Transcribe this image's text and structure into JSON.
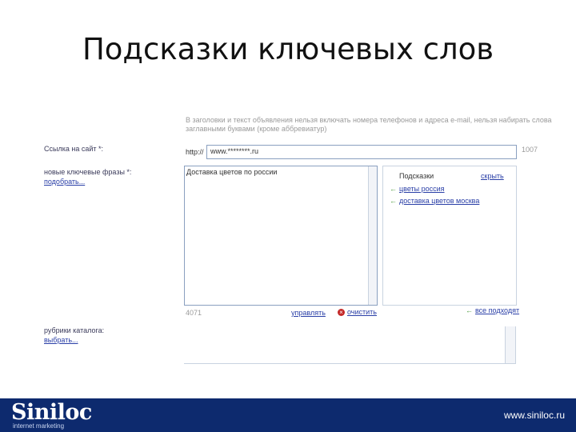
{
  "slide": {
    "title": "Подсказки ключевых слов"
  },
  "form": {
    "hint_top_line1": "В заголовки и текст объявления нельзя включать номера телефонов и адреса e-mail, нельзя набирать слова",
    "hint_top_line2": "заглавными буквами (кроме аббревиатур)",
    "link_label": "Ссылка на сайт *:",
    "url_prefix": "http://",
    "url_value": "www.********.ru",
    "char_count_top": "1007",
    "keywords_label": "новые ключевые фразы *:",
    "keywords_pick_link": "подобрать...",
    "keywords_value": "Доставка цветов по россии",
    "char_count_bottom": "4071",
    "manage_link": "управлять",
    "clear_link": "очистить",
    "rubrics_label": "рубрики каталога:",
    "rubrics_pick_link": "выбрать..."
  },
  "hints": {
    "title": "Подсказки",
    "hide_link": "скрыть",
    "items": [
      "цветы россия",
      "доставка цветов москва"
    ],
    "add_all_link": "все подходят"
  },
  "footer": {
    "logo": "Siniloc",
    "logo_sub": "internet marketing",
    "site": "www.siniloc.ru"
  },
  "colors": {
    "footer_bg": "#0d2a6e",
    "link": "#2a3fa7",
    "arrow": "#4a9a3a",
    "border": "#8aa0c0"
  },
  "icons": {
    "hint_arrow": "left-arrow-icon",
    "clear": "close-icon"
  }
}
